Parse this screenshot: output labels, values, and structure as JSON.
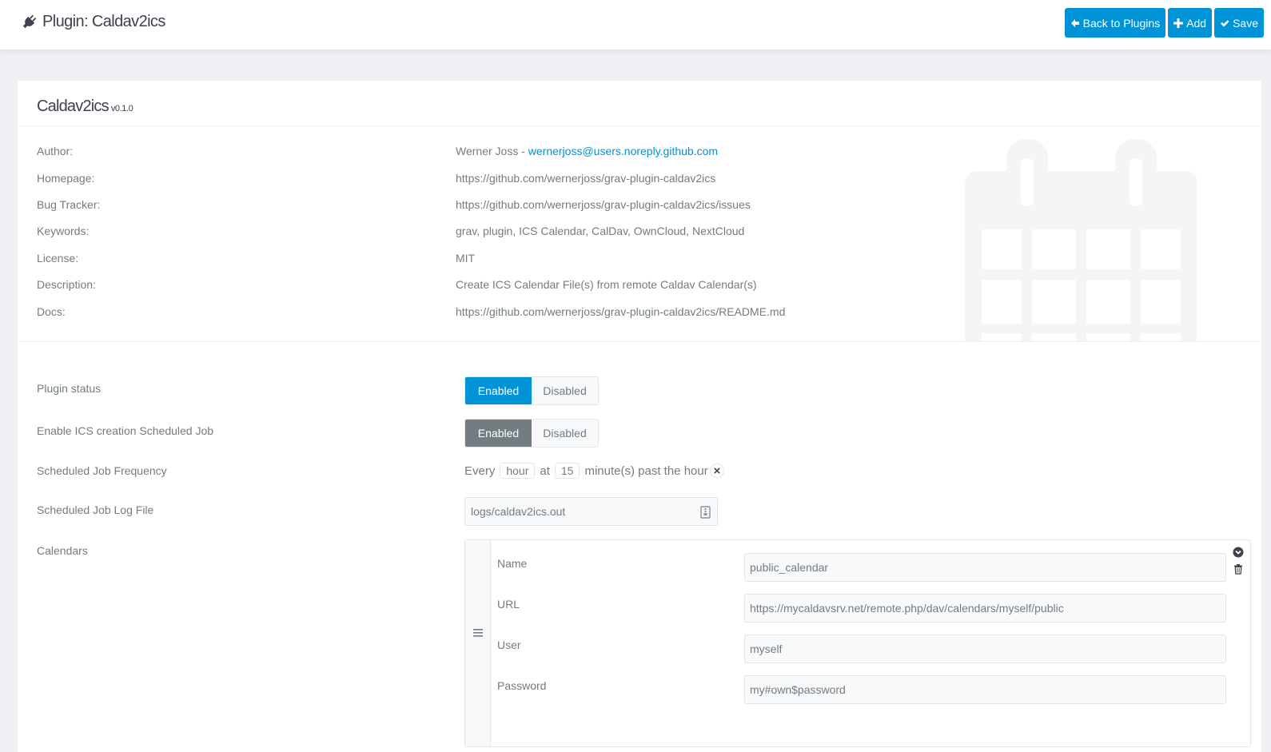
{
  "header": {
    "title": "Plugin: Caldav2ics",
    "buttons": {
      "back": "Back to Plugins",
      "add": "Add",
      "save": "Save"
    }
  },
  "plugin": {
    "name": "Caldav2ics",
    "version": "v0.1.0"
  },
  "info": {
    "author_label": "Author:",
    "author_name": "Werner Joss - ",
    "author_email": "wernerjoss@users.noreply.github.com",
    "homepage_label": "Homepage:",
    "homepage": "https://github.com/wernerjoss/grav-plugin-caldav2ics",
    "bugtracker_label": "Bug Tracker:",
    "bugtracker": "https://github.com/wernerjoss/grav-plugin-caldav2ics/issues",
    "keywords_label": "Keywords:",
    "keywords": "grav, plugin, ICS Calendar, CalDav, OwnCloud, NextCloud",
    "license_label": "License:",
    "license": "MIT",
    "description_label": "Description:",
    "description": "Create ICS Calendar File(s) from remote Caldav Calendar(s)",
    "docs_label": "Docs:",
    "docs": "https://github.com/wernerjoss/grav-plugin-caldav2ics/README.md"
  },
  "form": {
    "plugin_status": {
      "label": "Plugin status",
      "enabled": "Enabled",
      "disabled": "Disabled",
      "selected": "Enabled"
    },
    "scheduled_job": {
      "label": "Enable ICS creation Scheduled Job",
      "enabled": "Enabled",
      "disabled": "Disabled",
      "selected": "Enabled"
    },
    "frequency": {
      "label": "Scheduled Job Frequency",
      "every": "Every",
      "unit": "hour",
      "at": "at",
      "minute": "15",
      "suffix": "minute(s) past the hour"
    },
    "log_file": {
      "label": "Scheduled Job Log File",
      "value": "logs/caldav2ics.out"
    },
    "calendars": {
      "label": "Calendars",
      "item": {
        "name_label": "Name",
        "name_value": "public_calendar",
        "url_label": "URL",
        "url_value": "https://mycaldavsrv.net/remote.php/dav/calendars/myself/public",
        "user_label": "User",
        "user_value": "myself",
        "password_label": "Password",
        "password_value": "my#own$password"
      }
    }
  },
  "colors": {
    "accent": "#0093d8",
    "text": "#737c81",
    "heading": "#3d424e",
    "background": "#eef0f3"
  }
}
